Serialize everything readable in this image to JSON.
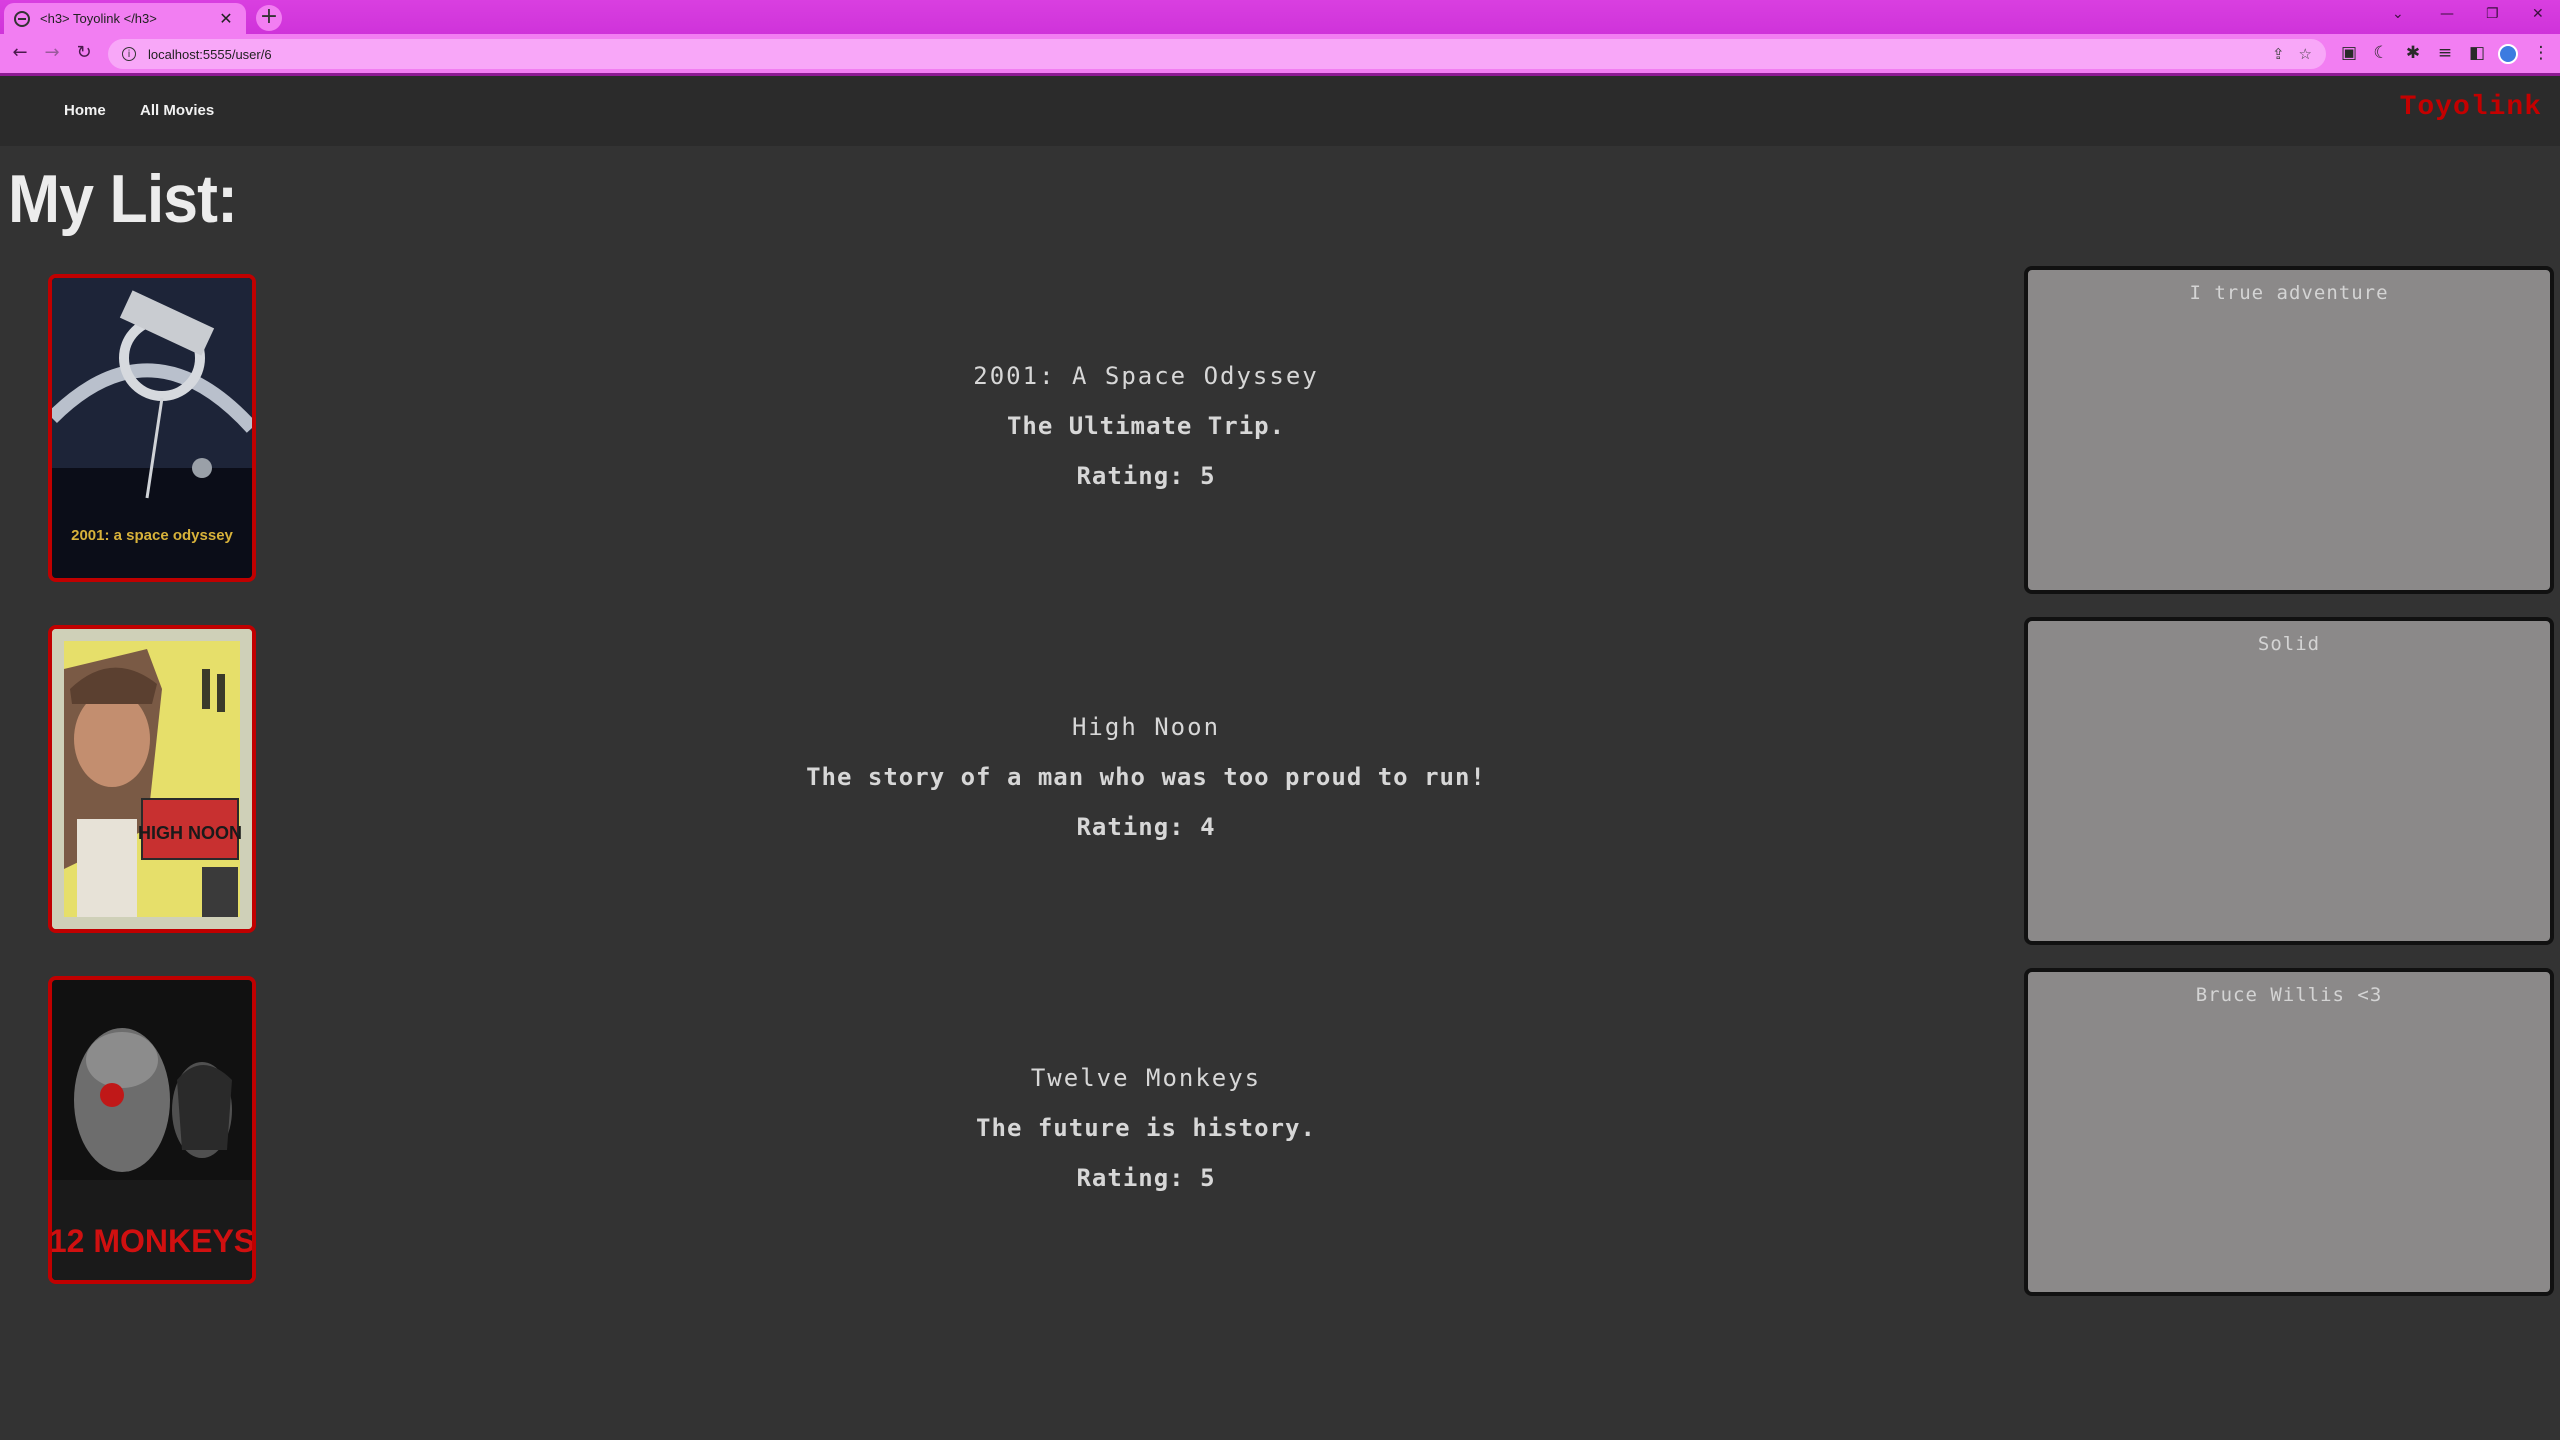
{
  "browser": {
    "tab_title": "<h3> Toyolink </h3>",
    "url": "localhost:5555/user/6"
  },
  "nav": {
    "home": "Home",
    "all_movies": "All Movies",
    "brand": "Toyolink"
  },
  "page": {
    "heading": "My List:"
  },
  "movies": [
    {
      "title": "2001: A Space Odyssey",
      "tagline": "The Ultimate Trip.",
      "rating": "Rating: 5",
      "review": "I true adventure",
      "poster_text": "2001: a space odyssey"
    },
    {
      "title": "High Noon",
      "tagline": "The story of a man who was too proud to run!",
      "rating": "Rating: 4",
      "review": "Solid",
      "poster_text": "HIGH NOON"
    },
    {
      "title": "Twelve Monkeys",
      "tagline": "The future is history.",
      "rating": "Rating: 5",
      "review": "Bruce Willis <3",
      "poster_text": "12 MONKEYS"
    }
  ],
  "colors": {
    "tab_bar": "#d93fe0",
    "toolbar": "#f27ef2",
    "page_bg": "#333333",
    "brand": "#c40000",
    "poster_border": "#c00000",
    "review_bg": "#8b8989"
  }
}
